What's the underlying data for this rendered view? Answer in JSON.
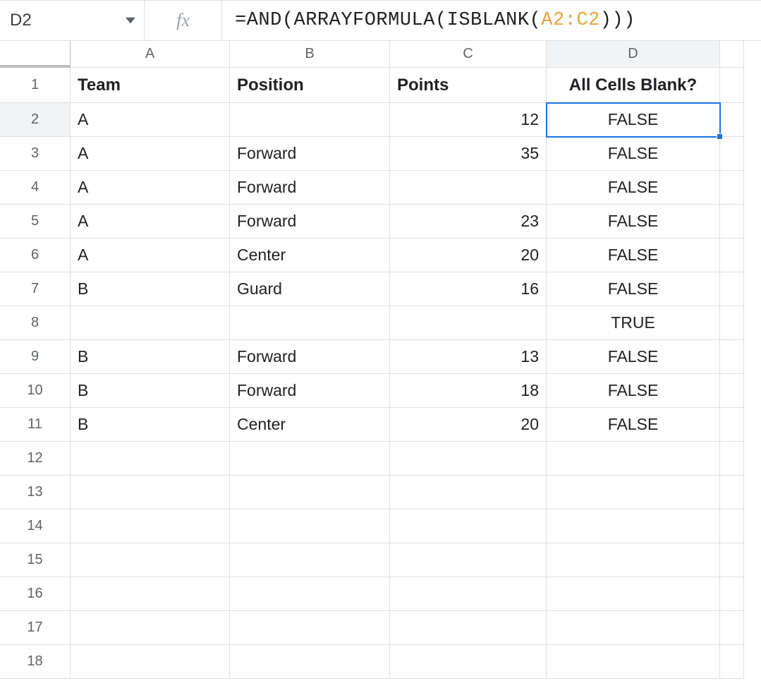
{
  "name_box": "D2",
  "formula": {
    "prefix": "=AND",
    "open1": "(",
    "fn2": "ARRAYFORMULA",
    "open2": "(",
    "fn3": "ISBLANK",
    "open3": "(",
    "ref": "A2:C2",
    "close": ")))"
  },
  "headers": {
    "A": "A",
    "B": "B",
    "C": "C",
    "D": "D"
  },
  "row_labels": [
    "1",
    "2",
    "3",
    "4",
    "5",
    "6",
    "7",
    "8",
    "9",
    "10",
    "11",
    "12",
    "13",
    "14",
    "15",
    "16",
    "17",
    "18"
  ],
  "columns": {
    "team": "Team",
    "position": "Position",
    "points": "Points",
    "blank": "All Cells Blank?"
  },
  "rows": [
    {
      "team": "A",
      "position": "",
      "points": "12",
      "blank": "FALSE"
    },
    {
      "team": "A",
      "position": "Forward",
      "points": "35",
      "blank": "FALSE"
    },
    {
      "team": "A",
      "position": "Forward",
      "points": "",
      "blank": "FALSE"
    },
    {
      "team": "A",
      "position": "Forward",
      "points": "23",
      "blank": "FALSE"
    },
    {
      "team": "A",
      "position": "Center",
      "points": "20",
      "blank": "FALSE"
    },
    {
      "team": "B",
      "position": "Guard",
      "points": "16",
      "blank": "FALSE"
    },
    {
      "team": "",
      "position": "",
      "points": "",
      "blank": "TRUE"
    },
    {
      "team": "B",
      "position": "Forward",
      "points": "13",
      "blank": "FALSE"
    },
    {
      "team": "B",
      "position": "Forward",
      "points": "18",
      "blank": "FALSE"
    },
    {
      "team": "B",
      "position": "Center",
      "points": "20",
      "blank": "FALSE"
    }
  ],
  "selected_cell": "D2"
}
